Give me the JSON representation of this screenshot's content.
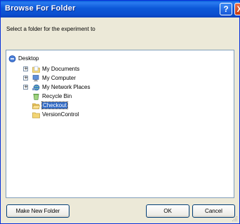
{
  "window": {
    "title": "Browse For Folder",
    "help_symbol": "?",
    "close_symbol": "X"
  },
  "prompt": "Select a folder for the experiment to",
  "tree": {
    "items": [
      {
        "label": "Desktop",
        "icon": "desktop-icon",
        "expander": ""
      },
      {
        "label": "My Documents",
        "icon": "documents-folder-icon",
        "expander": "+"
      },
      {
        "label": "My Computer",
        "icon": "computer-icon",
        "expander": "+"
      },
      {
        "label": "My Network Places",
        "icon": "network-places-icon",
        "expander": "+"
      },
      {
        "label": "Recycle Bin",
        "icon": "recycle-bin-icon",
        "expander": ""
      },
      {
        "label": "Checkout",
        "icon": "folder-open-icon",
        "expander": "",
        "selected": true
      },
      {
        "label": "VersionControl",
        "icon": "folder-icon",
        "expander": ""
      }
    ]
  },
  "buttons": {
    "new_folder": "Make New Folder",
    "ok": "OK",
    "cancel": "Cancel"
  },
  "colors": {
    "title_bar": "#0b4fd0",
    "dialog_face": "#ece9d8",
    "selection": "#316ac5",
    "close_button": "#c63b13"
  }
}
